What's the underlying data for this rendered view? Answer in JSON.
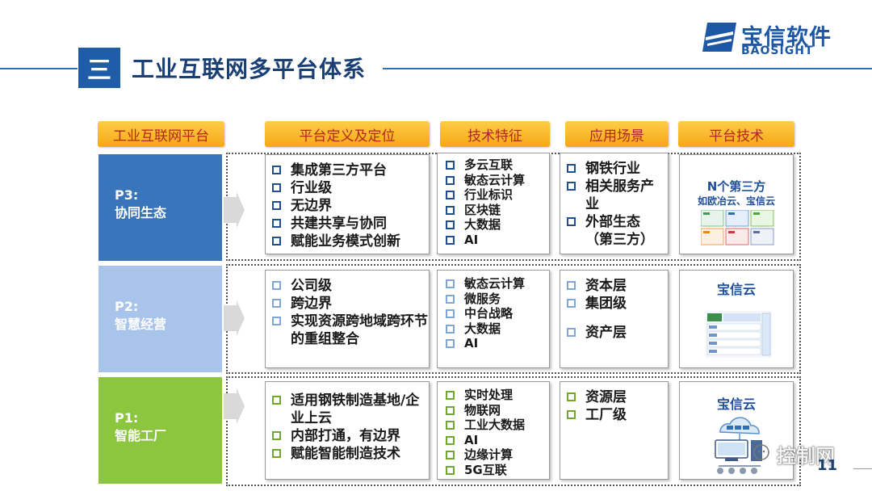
{
  "header": {
    "section_number": "三",
    "title": "工业互联网多平台体系"
  },
  "logo": {
    "name_cn": "宝信软件",
    "name_en": "BAOSIGHT"
  },
  "columns": {
    "platform": "工业互联网平台",
    "definition": "平台定义及定位",
    "tech_features": "技术特征",
    "scenarios": "应用场景",
    "platform_tech": "平台技术"
  },
  "rows": [
    {
      "id": "P3:",
      "name": "协同生态",
      "color": "#3a74ba",
      "definition": [
        "集成第三方平台",
        "行业级",
        "无边界",
        "共建共享与协同",
        "赋能业务模式创新"
      ],
      "tech": [
        "多云互联",
        "敏态云计算",
        "行业标识",
        "区块链",
        "大数据",
        "AI"
      ],
      "scenarios": [
        "钢铁行业",
        "相关服务产业",
        "外部生态（第三方）"
      ],
      "platform_tech_title": "N个第三方",
      "platform_tech_sub": "如欧冶云、宝信云"
    },
    {
      "id": "P2:",
      "name": "智慧经营",
      "color": "#a9c4ea",
      "definition": [
        "公司级",
        "跨边界",
        "实现资源跨地域跨环节的重组整合"
      ],
      "tech": [
        "敏态云计算",
        "微服务",
        "中台战略",
        "大数据",
        "AI"
      ],
      "scenarios": [
        "资本层",
        "集团级",
        "资产层"
      ],
      "platform_tech_title": "宝信云"
    },
    {
      "id": "P1:",
      "name": "智能工厂",
      "color": "#8cc63f",
      "definition": [
        "适用钢铁制造基地/企业上云",
        "内部打通，有边界",
        "赋能智能制造技术"
      ],
      "tech": [
        "实时处理",
        "物联网",
        "工业大数据",
        "AI",
        "边缘计算",
        "5G互联"
      ],
      "scenarios": [
        "资源层",
        "工厂级"
      ],
      "platform_tech_title": "宝信云"
    }
  ],
  "watermark": "控制网",
  "page_number": "11"
}
